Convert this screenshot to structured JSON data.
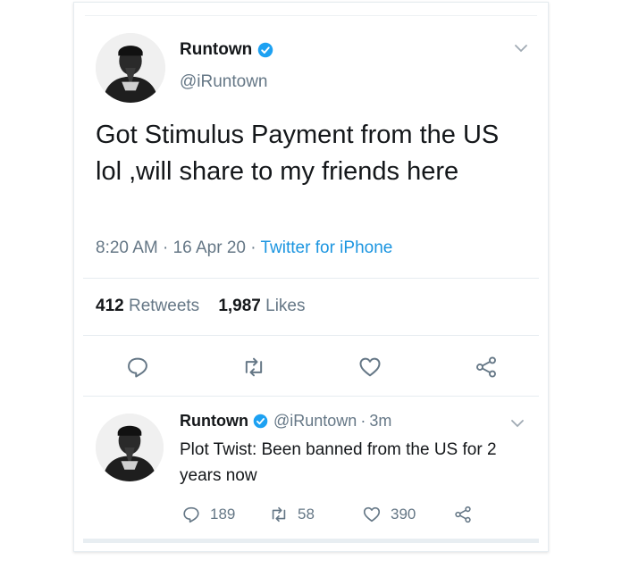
{
  "tweet": {
    "display_name": "Runtown",
    "handle": "@iRuntown",
    "text": "Got Stimulus Payment from the US lol ,will share to my friends here",
    "time": "8:20 AM",
    "date": "16 Apr 20",
    "separator": "·",
    "source": "Twitter for iPhone",
    "retweets_count": "412",
    "retweets_label": "Retweets",
    "likes_count": "1,987",
    "likes_label": "Likes"
  },
  "reply": {
    "display_name": "Runtown",
    "handle": "@iRuntown",
    "time": "3m",
    "separator": "·",
    "text": "Plot Twist: Been banned from the US for 2 years now",
    "reply_count": "189",
    "retweet_count": "58",
    "like_count": "390"
  },
  "icons": {
    "verified": "verified-badge-icon",
    "caret": "chevron-down-icon",
    "reply": "reply-icon",
    "retweet": "retweet-icon",
    "like": "heart-icon",
    "share": "share-icon"
  },
  "colors": {
    "text": "#14171a",
    "secondary": "#657786",
    "link": "#1b95e0",
    "verified": "#1da1f2",
    "divider": "#e6ecf0"
  }
}
